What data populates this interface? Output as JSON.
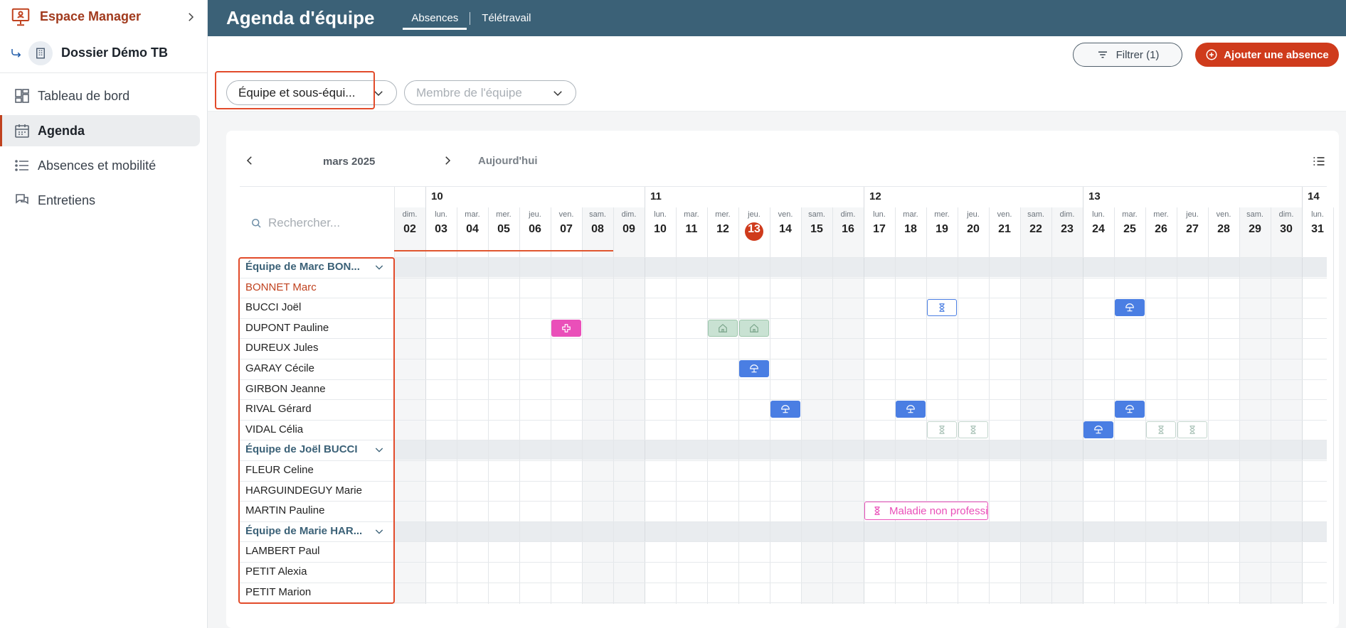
{
  "sidebar": {
    "brand": "Espace Manager",
    "dossier": "Dossier Démo TB",
    "items": [
      {
        "label": "Tableau de bord",
        "icon": "dashboard-icon"
      },
      {
        "label": "Agenda",
        "icon": "calendar-icon",
        "active": true
      },
      {
        "label": "Absences et mobilité",
        "icon": "list-icon"
      },
      {
        "label": "Entretiens",
        "icon": "chat-icon"
      }
    ]
  },
  "header": {
    "title": "Agenda d'équipe",
    "tabs": [
      {
        "label": "Absences",
        "active": true
      },
      {
        "label": "Télétravail"
      }
    ]
  },
  "actions": {
    "filter_label": "Filtrer (1)",
    "add_label": "Ajouter une absence"
  },
  "filters": {
    "team_value": "Équipe et sous-équi...",
    "member_placeholder": "Membre de l'équipe"
  },
  "calendar": {
    "month": "mars 2025",
    "today_label": "Aujourd'hui",
    "search_placeholder": "Rechercher...",
    "weeks": [
      "10",
      "11",
      "12",
      "13",
      "14"
    ],
    "days": [
      {
        "n": "dim.",
        "d": "02"
      },
      {
        "n": "lun.",
        "d": "03"
      },
      {
        "n": "mar.",
        "d": "04"
      },
      {
        "n": "mer.",
        "d": "05"
      },
      {
        "n": "jeu.",
        "d": "06"
      },
      {
        "n": "ven.",
        "d": "07"
      },
      {
        "n": "sam.",
        "d": "08"
      },
      {
        "n": "dim.",
        "d": "09"
      },
      {
        "n": "lun.",
        "d": "10"
      },
      {
        "n": "mar.",
        "d": "11"
      },
      {
        "n": "mer.",
        "d": "12"
      },
      {
        "n": "jeu.",
        "d": "13"
      },
      {
        "n": "ven.",
        "d": "14"
      },
      {
        "n": "sam.",
        "d": "15"
      },
      {
        "n": "dim.",
        "d": "16"
      },
      {
        "n": "lun.",
        "d": "17"
      },
      {
        "n": "mar.",
        "d": "18"
      },
      {
        "n": "mer.",
        "d": "19"
      },
      {
        "n": "jeu.",
        "d": "20"
      },
      {
        "n": "ven.",
        "d": "21"
      },
      {
        "n": "sam.",
        "d": "22"
      },
      {
        "n": "dim.",
        "d": "23"
      },
      {
        "n": "lun.",
        "d": "24"
      },
      {
        "n": "mar.",
        "d": "25"
      },
      {
        "n": "mer.",
        "d": "26"
      },
      {
        "n": "jeu.",
        "d": "27"
      },
      {
        "n": "ven.",
        "d": "28"
      },
      {
        "n": "sam.",
        "d": "29"
      },
      {
        "n": "dim.",
        "d": "30"
      },
      {
        "n": "lun.",
        "d": "31"
      }
    ],
    "today": "13",
    "rows": [
      {
        "type": "team",
        "label": "Équipe de Marc BON..."
      },
      {
        "type": "person",
        "label": "BONNET Marc",
        "me": true
      },
      {
        "type": "person",
        "label": "BUCCI Joël"
      },
      {
        "type": "person",
        "label": "DUPONT Pauline"
      },
      {
        "type": "person",
        "label": "DUREUX Jules"
      },
      {
        "type": "person",
        "label": "GARAY Cécile"
      },
      {
        "type": "person",
        "label": "GIRBON Jeanne"
      },
      {
        "type": "person",
        "label": "RIVAL Gérard"
      },
      {
        "type": "person",
        "label": "VIDAL Célia"
      },
      {
        "type": "team",
        "label": "Équipe de Joël BUCCI"
      },
      {
        "type": "person",
        "label": "FLEUR Celine"
      },
      {
        "type": "person",
        "label": "HARGUINDEGUY Marie"
      },
      {
        "type": "person",
        "label": "MARTIN Pauline"
      },
      {
        "type": "team",
        "label": "Équipe de Marie HAR..."
      },
      {
        "type": "person",
        "label": "LAMBERT Paul"
      },
      {
        "type": "person",
        "label": "PETIT Alexia"
      },
      {
        "type": "person",
        "label": "PETIT Marion"
      }
    ],
    "events": [
      {
        "row": 2,
        "day": 17,
        "style": "outline-blue",
        "icon": "hourglass-icon"
      },
      {
        "row": 2,
        "day": 23,
        "style": "blue",
        "icon": "umbrella-icon"
      },
      {
        "row": 3,
        "day": 5,
        "style": "pink",
        "icon": "medical-cross-icon"
      },
      {
        "row": 3,
        "day": 10,
        "style": "green",
        "icon": "home-icon"
      },
      {
        "row": 3,
        "day": 11,
        "style": "green",
        "icon": "home-icon"
      },
      {
        "row": 5,
        "day": 11,
        "style": "blue",
        "icon": "umbrella-icon"
      },
      {
        "row": 7,
        "day": 12,
        "style": "blue",
        "icon": "umbrella-icon"
      },
      {
        "row": 7,
        "day": 16,
        "style": "blue",
        "icon": "umbrella-icon"
      },
      {
        "row": 7,
        "day": 23,
        "style": "blue",
        "icon": "umbrella-icon"
      },
      {
        "row": 8,
        "day": 17,
        "style": "outline-gray",
        "icon": "hourglass-icon"
      },
      {
        "row": 8,
        "day": 18,
        "style": "outline-gray",
        "icon": "hourglass-icon"
      },
      {
        "row": 8,
        "day": 22,
        "style": "blue",
        "icon": "umbrella-icon"
      },
      {
        "row": 8,
        "day": 24,
        "style": "outline-gray",
        "icon": "hourglass-icon"
      },
      {
        "row": 8,
        "day": 25,
        "style": "outline-gray",
        "icon": "hourglass-icon"
      }
    ],
    "wide_event": {
      "row": 12,
      "day_start": 15,
      "day_end": 19,
      "label": "Maladie non professionne",
      "icon": "hourglass-icon"
    }
  },
  "colors": {
    "header": "#3b6177",
    "accent": "#cf3b1c",
    "event_blue": "#4a7ee3",
    "event_pink": "#ea4fb9"
  }
}
